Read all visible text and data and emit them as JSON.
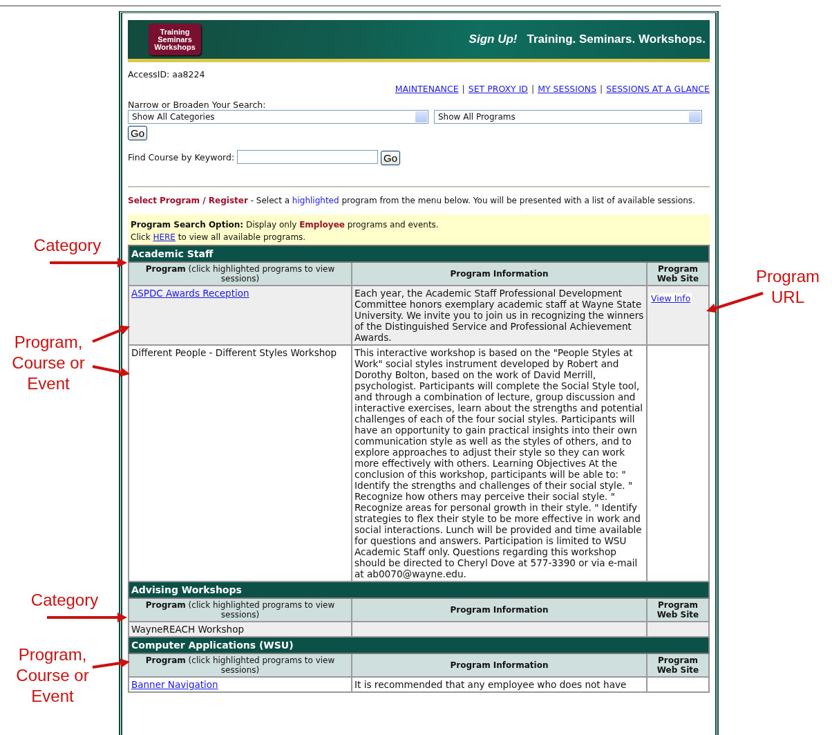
{
  "header": {
    "logo": "Training Seminars Workshops",
    "tagline_lead": "Sign Up!",
    "tagline": "Training. Seminars. Workshops."
  },
  "access_id": "AccessID: aa8224",
  "nav_links": [
    "MAINTENANCE",
    "SET PROXY ID",
    "MY SESSIONS",
    "SESSIONS AT A GLANCE"
  ],
  "nav_separator": "|",
  "search": {
    "label": "Narrow or Broaden Your Search:",
    "category_select": "Show All Categories",
    "program_select": "Show All Programs",
    "go": "Go"
  },
  "keyword": {
    "label": "Find Course by Keyword:",
    "go": "Go"
  },
  "instructions": {
    "heading": "Select Program / Register",
    "before": " - Select a ",
    "highlight": "highlighted",
    "after": " program from the menu below. You will be presented with a list of available sessions."
  },
  "notice": {
    "lead": "Program Search Option:",
    "before": " Display only ",
    "emphasis": "Employee",
    "after": " programs and events.",
    "line2_before": "Click ",
    "link": "HERE",
    "line2_after": " to view all available programs."
  },
  "categories": [
    {
      "name": "Academic Staff",
      "columns": [
        "**Program** (click highlighted programs to view sessions)",
        "Program Information",
        "Program Web Site"
      ],
      "rows": [
        {
          "program": "ASPDC Awards Reception ",
          "link": true,
          "shaded": true,
          "info": "Each year, the Academic Staff Professional Development Committee honors exemplary academic staff at Wayne State University. We invite you to join us in recognizing the winners of the Distinguished Service and Professional Achievement Awards.",
          "website": "View Info "
        },
        {
          "program": "Different People - Different Styles Workshop",
          "link": false,
          "shaded": false,
          "info": "This interactive workshop is based on the \"People Styles at Work\" social styles instrument developed by Robert and Dorothy Bolton, based on the work of David Merrill, psychologist. Participants will complete the Social Style tool, and through a combination of lecture, group discussion and interactive exercises, learn about the strengths and potential challenges of each of the four social styles. Participants will have an opportunity to gain practical insights into their own communication style as well as the styles of others, and to explore approaches to adjust their style so they can work more effectively with others. Learning Objectives At the conclusion of this workshop, participants will be able to: \" Identify the strengths and challenges of their social style. \" Recognize how others may perceive their social style. \" Recognize areas for personal growth in their style. \" Identify strategies to flex their style to be more effective in work and social interactions. Lunch will be provided and time available for questions and answers. Participation is limited to WSU Academic Staff only. Questions regarding this workshop should be directed to Cheryl Dove at 577-3390 or via e-mail at ab0070@wayne.edu."
        }
      ]
    },
    {
      "name": "Advising Workshops",
      "columns": [
        "**Program** (click highlighted programs to view sessions)",
        "Program Information",
        "Program Web Site"
      ],
      "rows": [
        {
          "program": "WayneREACH Workshop",
          "link": false,
          "shaded": true
        }
      ]
    },
    {
      "name": "Computer Applications (WSU)",
      "columns": [
        "**Program** (click highlighted programs to view sessions)",
        "Program Information",
        "Program Web Site"
      ],
      "rows": [
        {
          "program": "Banner Navigation",
          "link": true,
          "shaded": false,
          "info": "It is recommended that any employee who does not have"
        }
      ]
    }
  ],
  "annotations": [
    {
      "text": "Category"
    },
    {
      "text": "Program URL"
    },
    {
      "text": "Program, Course or Event"
    },
    {
      "text": "Category"
    },
    {
      "text": "Program, Course or Event"
    }
  ]
}
